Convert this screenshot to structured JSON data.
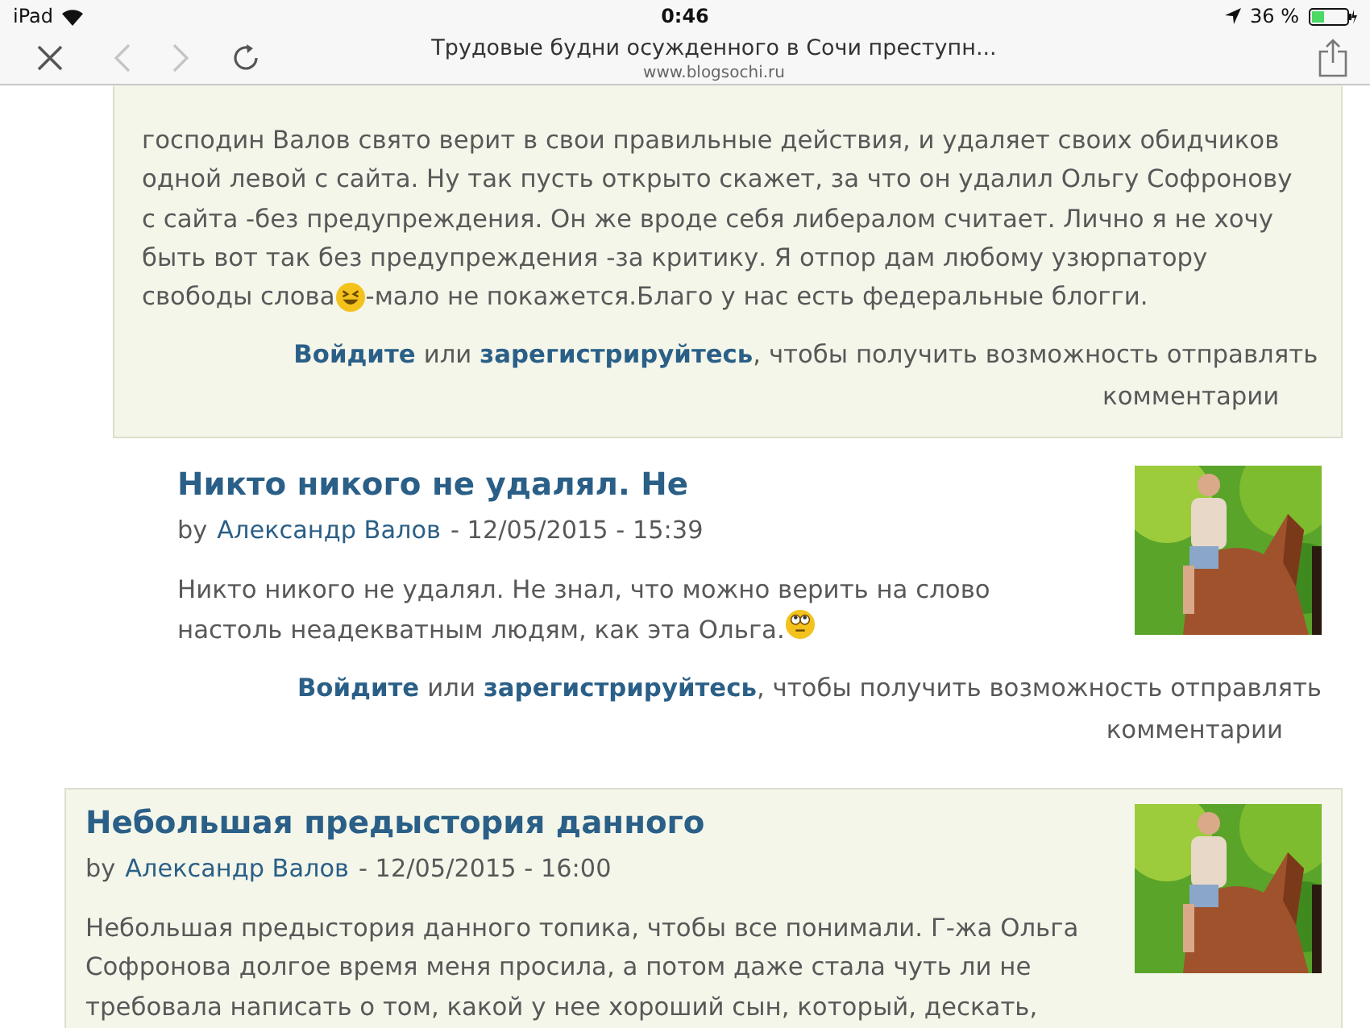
{
  "status_bar": {
    "device": "iPad",
    "time": "0:46",
    "battery": "36 %"
  },
  "browser": {
    "title": "Трудовые будни осужденного в Сочи преступн...",
    "url": "www.blogsochi.ru",
    "back_disabled": true,
    "forward_disabled": true
  },
  "comments": [
    {
      "kind": "comment",
      "lines": [
        [
          {
            "kind": "text",
            "text": "господин Валов свято верит в свои правильные действия, и удаляет своих обидчиков"
          }
        ],
        [
          {
            "kind": "text",
            "text": "одной левой с сайта. Ну так пусть открыто скажет, за что он удалил Ольгу Софронову"
          }
        ],
        [
          {
            "kind": "text",
            "text": "с сайта -без предупреждения. Он же вроде себя либералом считает. Лично я не хочу"
          }
        ],
        [
          {
            "kind": "text",
            "text": "быть вот так без предупреждения -за критику. Я отпор дам  любому узюрпатору"
          }
        ],
        [
          {
            "kind": "text",
            "text": "свободы слова"
          },
          {
            "kind": "laughing"
          },
          {
            "kind": "text",
            "text": "-мало не покажется.Благо у нас есть федеральные блогги."
          }
        ]
      ],
      "notice": {
        "login": "Войдите",
        "or": "или",
        "register": "зарегистрируйтесь",
        "rest": ", чтобы получить возможность отправлять",
        "rest_2": "комментарии"
      }
    },
    {
      "kind": "reply",
      "title": "Никто никого не удалял. Не",
      "by": "by",
      "author": "Александр Валов",
      "date": "- 12/05/2015 - 15:39",
      "photo": true,
      "lines": [
        [
          {
            "kind": "text",
            "text": "Никто никого не удалял. Не знал, что можно верить на слово"
          }
        ],
        [
          {
            "kind": "text",
            "text": "настоль неадекватным людям, как эта Ольга."
          },
          {
            "kind": "rolling"
          }
        ]
      ],
      "notice": {
        "login": "Войдите",
        "or": "или",
        "register": "зарегистрируйтесь",
        "rest": ", чтобы получить возможность отправлять",
        "rest_2": "комментарии"
      }
    },
    {
      "kind": "comment",
      "title": "Небольшая предыстория данного",
      "by": "by",
      "author": "Александр Валов",
      "date": "- 12/05/2015 - 16:00",
      "photo": true,
      "lines": [
        [
          {
            "kind": "text",
            "text": "Небольшая предыстория данного топика, чтобы все понимали. Г-жа Ольга"
          }
        ],
        [
          {
            "kind": "text",
            "text": "Софронова долгое время меня просила, а потом даже стала чуть ли не"
          }
        ],
        [
          {
            "kind": "text",
            "text": "требовала написать о том, какой у нее хороший сын, который, дескать,"
          }
        ]
      ]
    }
  ]
}
